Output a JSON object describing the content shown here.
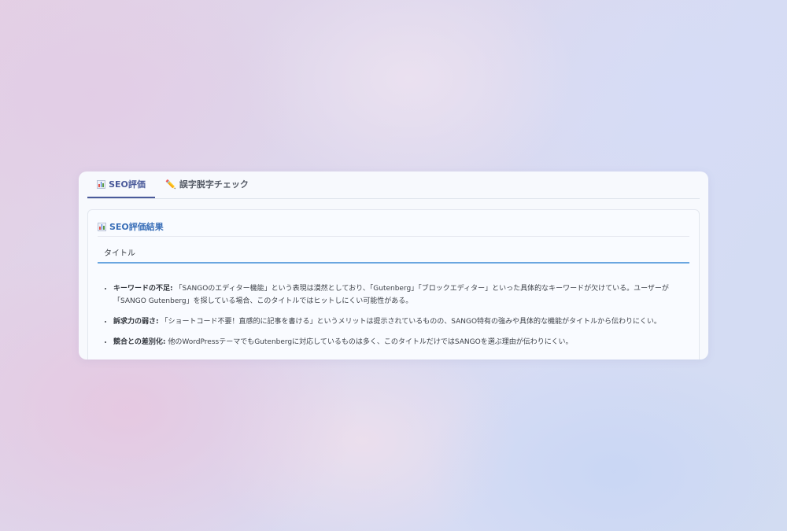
{
  "tabs": [
    {
      "icon": "bar-chart-icon",
      "label": "SEO評価",
      "active": true
    },
    {
      "icon": "pencil-icon",
      "glyph": "✏️",
      "label": "誤字脱字チェック",
      "active": false
    }
  ],
  "result": {
    "title": "SEO評価結果",
    "field_label": "タイトル",
    "points": [
      {
        "heading": "キーワードの不足:",
        "text": " 「SANGOのエディター機能」という表現は漠然としており、「Gutenberg」「ブロックエディター」といった具体的なキーワードが欠けている。ユーザーが「SANGO Gutenberg」を探している場合、このタイトルではヒットしにくい可能性がある。"
      },
      {
        "heading": "訴求力の弱さ:",
        "text": " 「ショートコード不要！直感的に記事を書ける」というメリットは提示されているものの、SANGO特有の強みや具体的な機能がタイトルから伝わりにくい。"
      },
      {
        "heading": "競合との差別化:",
        "text": " 他のWordPressテーマでもGutenbergに対応しているものは多く、このタイトルだけではSANGOを選ぶ理由が伝わりにくい。"
      }
    ]
  },
  "colors": {
    "active_tab": "#4a5a9a",
    "card_title": "#3a6fb8",
    "field_underline": "#6aa6e0"
  }
}
